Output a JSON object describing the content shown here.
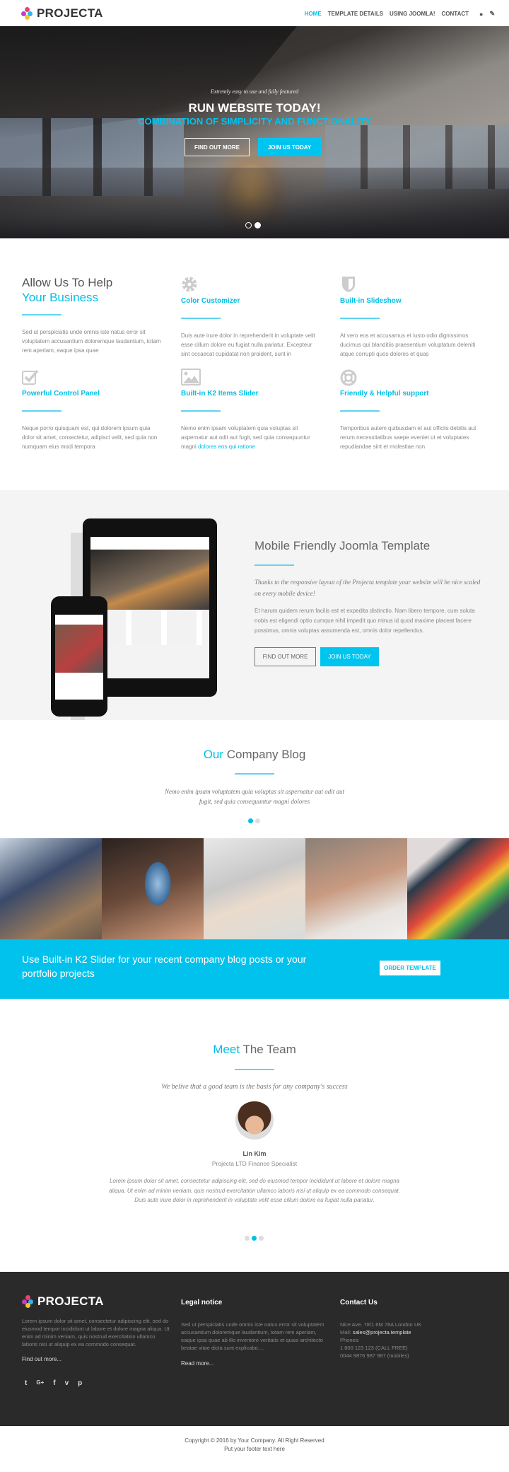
{
  "brand": {
    "name": "PROJECTA",
    "dot_colors": [
      "#e8417a",
      "#2fb6ea",
      "#f6c333",
      "#8e5ac8"
    ]
  },
  "accent": "#00bfe8",
  "nav": {
    "items": [
      {
        "label": "HOME",
        "active": true
      },
      {
        "label": "TEMPLATE DETAILS"
      },
      {
        "label": "USING JOOMLA!"
      },
      {
        "label": "CONTACT"
      }
    ],
    "icons": [
      "user-icon",
      "pencil-icon"
    ]
  },
  "hero": {
    "subtitle": "Extremly easy to use and fully featured",
    "title": "RUN WEBSITE TODAY!",
    "title2": "COMBINATION OF SIMPLICITY AND FUNCTIONALITY",
    "btn1": "FIND OUT MORE",
    "btn2": "JOIN US TODAY",
    "slides": 2,
    "active_slide": 2
  },
  "features": {
    "heading1": "Allow Us To Help",
    "heading2": "Your Business",
    "intro": "Sed ut perspiciatis unde omnis iste natus error sit voluptatem accusantium doloremque laudantium, totam rem aperiam, eaque ipsa quae",
    "items": [
      {
        "icon": "gear-icon",
        "title": "Color Customizer",
        "text": "Duis aute irure dolor in reprehenderit in voluptate velit esse cillum dolore eu fugiat nulla pariatur. Excepteur sint occaecat cupidatat non proident, sunt in"
      },
      {
        "icon": "shield-icon",
        "title": "Built-in Slideshow",
        "text": "At vero eos et accusamus et iusto odio dignissimos ducimus qui blanditiis praesentium voluptatum deleniti atque corrupti quos dolores et quas"
      },
      {
        "icon": "checkbox-icon",
        "title": "Powerful Control Panel",
        "text": "Neque porro quisquam est, qui dolorem ipsum quia dolor sit amet, consectetur, adipisci velit, sed quia non numquam eius modi tempora"
      },
      {
        "icon": "image-icon",
        "title": "Built-in K2 Items Slider",
        "text": "Nemo enim ipsam voluptatem quia voluptas sit aspernatur aut odit aut fugit, sed quia consequuntur magni ",
        "link": "dolores eos qui ratione"
      },
      {
        "icon": "lifebuoy-icon",
        "title": "Friendly & Helpful support",
        "text": "Temporibus autem quibusdam et aut officiis debitis aut rerum necessitatibus saepe eveniet ut et voluptates repudiandae sint et molestiae non"
      }
    ]
  },
  "mobile": {
    "title": "Mobile Friendly Joomla Template",
    "italic": "Thanks to the responsive layout of the Projecta template your website will be nice scaled on every mobile device!",
    "text": "Et harum quidem rerum facilis est et expedita distinctio. Nam libero tempore, cum soluta nobis est eligendi optio cumque nihil impedit quo minus id quod maxime placeat facere possimus, omnis voluptas assumenda est, omnis dolor repellendus.",
    "btn1": "FIND OUT MORE",
    "btn2": "JOIN US TODAY"
  },
  "blog": {
    "title_accent": "Our",
    "title_rest": " Company Blog",
    "quote": "Nemo enim ipsam voluptatem quia voluptas sit aspernatur aut odit aut fugit, sed quia consequuntur magni dolores",
    "dots": 2,
    "active_dot": 1
  },
  "band": {
    "text": "Use Built-in K2 Slider for your recent company blog posts or your portfolio projects",
    "button": "ORDER TEMPLATE"
  },
  "team": {
    "title_accent": "Meet",
    "title_rest": " The Team",
    "quote": "We belive that a good team is the basis for any company's success",
    "member": {
      "name": "Lin Kim",
      "role": "Projecta LTD Finance Specialist",
      "bio": "Lorem ipsum dolor sit amet, consectetur adipiscing elit, sed do eiusmod tempor incididunt ut labore et dolore magna aliqua. Ut enim ad minim veniam, quis nostrud exercitation ullamco laboris nisi ut aliquip ex ea commodo consequat. Duis aute irure dolor in reprehenderit in voluptate velit esse cillum dolore eu fugiat nulla pariatur."
    },
    "dots": 3,
    "active_dot": 2
  },
  "footer": {
    "about": "Lorem ipsum dolor sit amet, consectetur adipiscing elit, sed do eiusmod tempor incididunt ut labore et dolore magna aliqua. Ut enim ad minim veniam, quis nostrud exercitation ullamco laboris nisi ut aliquip ex ea commodo consequat.",
    "about_link": "Find out more...",
    "social": [
      "twitter-icon",
      "google-plus-icon",
      "facebook-icon",
      "vimeo-icon",
      "pinterest-icon"
    ],
    "legal_title": "Legal notice",
    "legal_text": "Sed ut perspiciatis unde omnis iste natus error sit voluptatem accusantium doloremque laudantium, totam rem aperiam, eaque ipsa quae ab illo inventore veritatis et quasi architecto beatae vitae dicta sunt explicabo....",
    "legal_link": "Read more...",
    "contact_title": "Contact Us",
    "address": "Nice Ave. 78/1 6M 78A London UK",
    "mail_label": "Mail: ",
    "mail": "sales@projecta.template",
    "phones_label": "Phones:",
    "phone1": "1 800 123 123 (CALL FREE)",
    "phone2": "0044 9876 987 987 (mobiles)",
    "copyright": "Copyright © 2016 by Your Company. All Right Reserved",
    "footer_text": "Put your footer text here"
  }
}
